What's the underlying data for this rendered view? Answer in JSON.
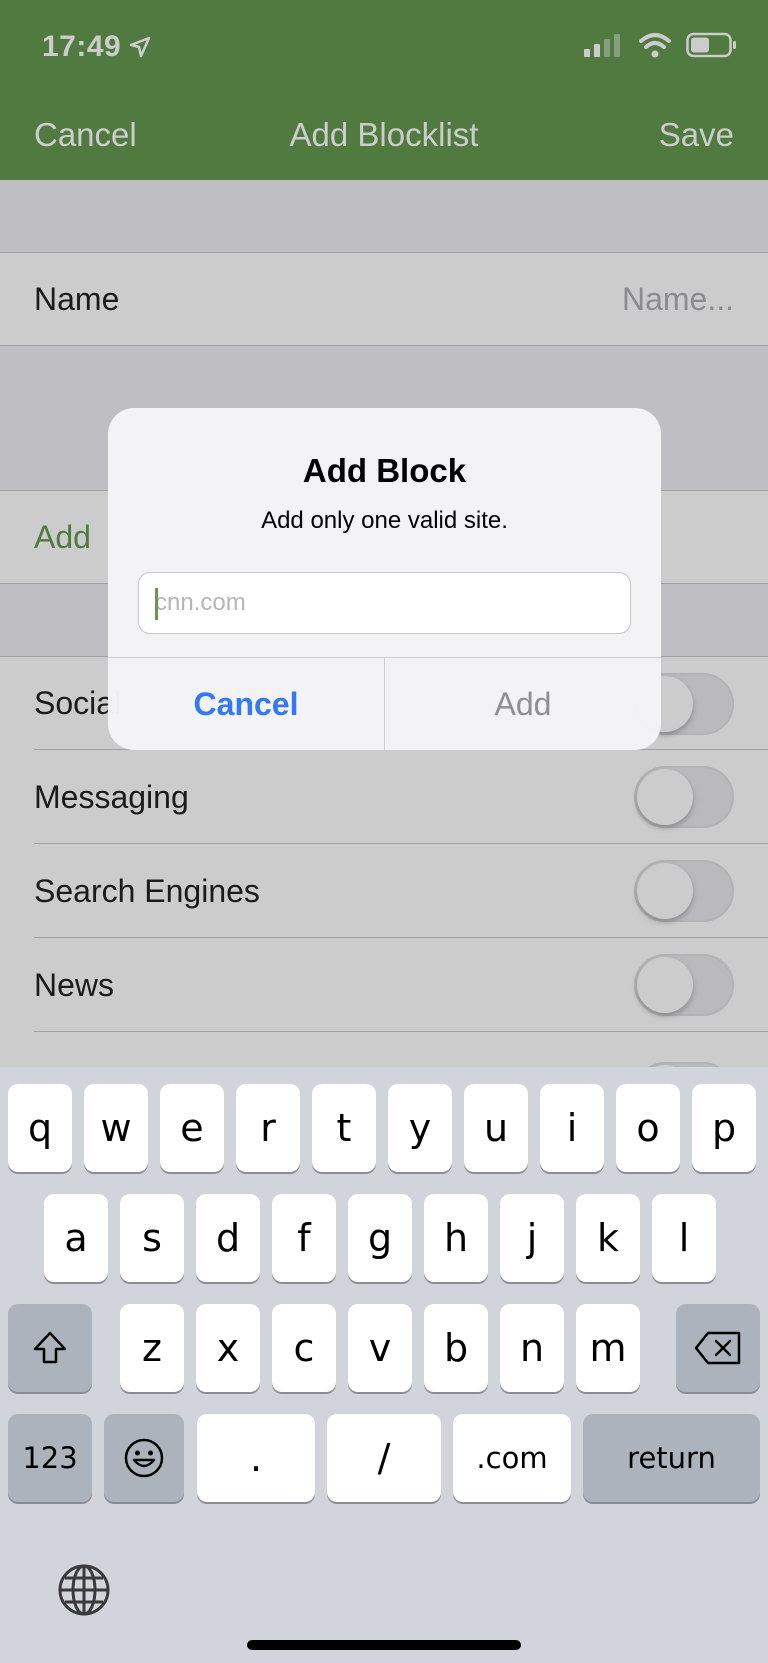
{
  "status_bar": {
    "time": "17:49"
  },
  "nav": {
    "cancel": "Cancel",
    "title": "Add Blocklist",
    "save": "Save"
  },
  "form": {
    "name_label": "Name",
    "name_placeholder": "Name...",
    "add_label": "Add",
    "categories": [
      {
        "label": "Social",
        "on": false
      },
      {
        "label": "Messaging",
        "on": false
      },
      {
        "label": "Search Engines",
        "on": false
      },
      {
        "label": "News",
        "on": false
      }
    ]
  },
  "alert": {
    "title": "Add Block",
    "message": "Add only one valid site.",
    "input_placeholder": "cnn.com",
    "cancel": "Cancel",
    "add": "Add"
  },
  "keyboard": {
    "row1": [
      "q",
      "w",
      "e",
      "r",
      "t",
      "y",
      "u",
      "i",
      "o",
      "p"
    ],
    "row2": [
      "a",
      "s",
      "d",
      "f",
      "g",
      "h",
      "j",
      "k",
      "l"
    ],
    "row3": [
      "z",
      "x",
      "c",
      "v",
      "b",
      "n",
      "m"
    ],
    "numbers": "123",
    "dot": ".",
    "slash": "/",
    "dotcom": ".com",
    "return": "return"
  },
  "colors": {
    "accent": "#64994f",
    "alert_button": "#3478f6"
  }
}
